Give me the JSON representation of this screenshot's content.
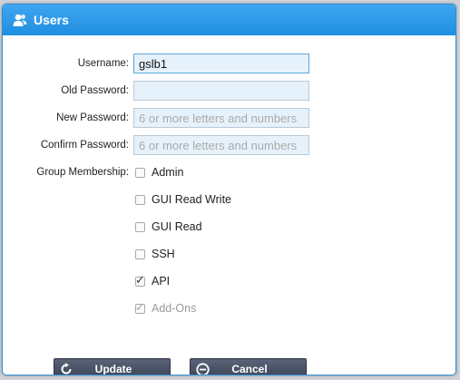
{
  "dialog": {
    "title": "Users",
    "title_icon": "users-icon"
  },
  "form": {
    "username": {
      "label": "Username:",
      "value": "gslb1",
      "placeholder": ""
    },
    "old_password": {
      "label": "Old Password:",
      "value": "",
      "placeholder": ""
    },
    "new_password": {
      "label": "New Password:",
      "value": "",
      "placeholder": "6 or more letters and numbers"
    },
    "confirm_password": {
      "label": "Confirm Password:",
      "value": "",
      "placeholder": "6 or more letters and numbers"
    }
  },
  "group_membership": {
    "label": "Group Membership:",
    "options": [
      {
        "label": "Admin",
        "checked": false,
        "disabled": false
      },
      {
        "label": "GUI Read Write",
        "checked": false,
        "disabled": false
      },
      {
        "label": "GUI Read",
        "checked": false,
        "disabled": false
      },
      {
        "label": "SSH",
        "checked": false,
        "disabled": false
      },
      {
        "label": "API",
        "checked": true,
        "disabled": false
      },
      {
        "label": "Add-Ons",
        "checked": true,
        "disabled": true
      }
    ]
  },
  "buttons": {
    "update": {
      "label": "Update",
      "icon": "refresh-icon"
    },
    "cancel": {
      "label": "Cancel",
      "icon": "cancel-circle-icon"
    }
  },
  "colors": {
    "titlebar": "#2a9ae6",
    "field_bg": "#e6f2fb",
    "button_bg": "#474f63"
  }
}
